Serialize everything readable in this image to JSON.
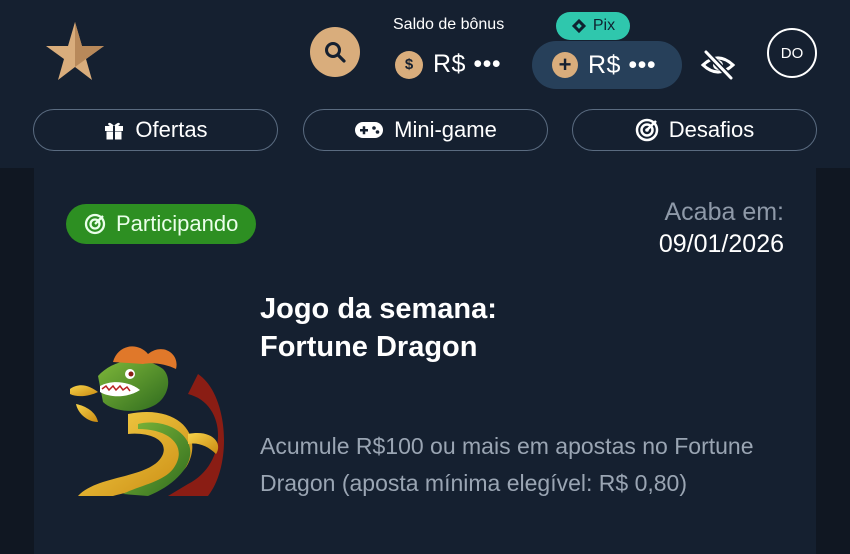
{
  "header": {
    "bonus_label": "Saldo de bônus",
    "bonus_balance": "R$ •••",
    "pix_label": "Pix",
    "deposit_balance": "R$ •••",
    "avatar_initials": "DO",
    "coin_symbol": "$",
    "icons": [
      "star-logo-icon",
      "search-icon",
      "coin-icon",
      "pix-icon",
      "plus-icon",
      "eye-slash-icon"
    ]
  },
  "tabs": [
    {
      "label": "Ofertas",
      "icon": "gift-icon"
    },
    {
      "label": "Mini-game",
      "icon": "gamepad-icon"
    },
    {
      "label": "Desafios",
      "icon": "target-icon"
    }
  ],
  "card": {
    "status": "Participando",
    "ends_label": "Acaba em:",
    "ends_date": "09/01/2026",
    "title_line1": "Jogo da semana:",
    "title_line2": "Fortune Dragon",
    "description": "Acumule R$100 ou mais em apostas no Fortune Dragon (aposta mínima elegível: R$ 0,80)"
  },
  "colors": {
    "background": "#101722",
    "panel": "#152030",
    "accent_gold": "#d9ad7c",
    "pix_teal": "#2fc7ad",
    "status_green": "#2d8f22"
  }
}
